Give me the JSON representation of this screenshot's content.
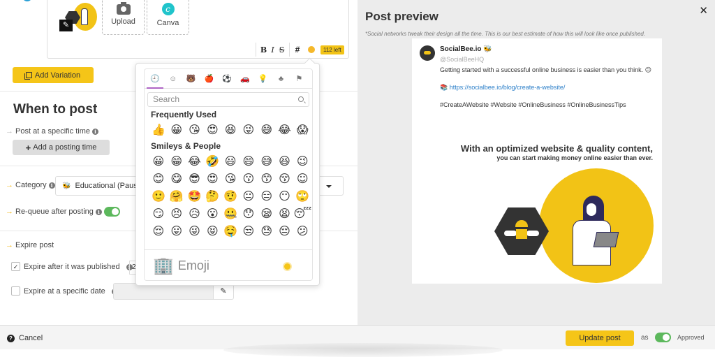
{
  "editor": {
    "upload_label": "Upload",
    "canva_label": "Canva",
    "toolbar": {
      "bold": "B",
      "italic": "I",
      "strike": "S",
      "hashtag": "#",
      "chars_left": "112 left"
    }
  },
  "add_variation_label": "Add Variation",
  "when_to_post": {
    "title": "When to post",
    "specific_time_label": "Post at a specific time",
    "add_time_label": "Add a posting time"
  },
  "category": {
    "label": "Category",
    "selected": "Educational (Paused)",
    "selected_visible": "Educational (Pause",
    "icon": "🐝"
  },
  "requeue": {
    "label": "Re-queue after posting",
    "enabled": true
  },
  "expire": {
    "label": "Expire post",
    "after_published": {
      "label": "Expire after it was published",
      "checked": true,
      "value": "2"
    },
    "specific_date": {
      "label": "Expire at a specific date",
      "checked": false,
      "value": ""
    }
  },
  "emoji_picker": {
    "categories": [
      "recent-icon",
      "smileys-icon",
      "animals-icon",
      "food-icon",
      "activity-icon",
      "travel-icon",
      "objects-icon",
      "symbols-icon",
      "flags-icon"
    ],
    "category_glyphs": [
      "🕘",
      "☺",
      "🐻",
      "🍎",
      "⚽",
      "🚗",
      "💡",
      "♣",
      "⚑"
    ],
    "search_placeholder": "Search",
    "frequently_used_title": "Frequently Used",
    "frequently_used": [
      "👍",
      "😀",
      "😘",
      "😍",
      "😆",
      "😜",
      "😅",
      "😂",
      "😱"
    ],
    "smileys_title": "Smileys & People",
    "smileys": [
      "😀",
      "😁",
      "😂",
      "🤣",
      "😃",
      "😄",
      "😅",
      "😆",
      "😉",
      "😊",
      "😋",
      "😎",
      "😍",
      "😘",
      "😗",
      "😙",
      "😚",
      "☺",
      "🙂",
      "🤗",
      "🤩",
      "🤔",
      "🤨",
      "😐",
      "😑",
      "😶",
      "🙄",
      "😏",
      "😣",
      "😥",
      "😮",
      "🤐",
      "😯",
      "😪",
      "😫",
      "😴",
      "😌",
      "😛",
      "😜",
      "😝",
      "🤤",
      "😒",
      "😓",
      "😔",
      "😕"
    ],
    "footer_emoji": "🏢",
    "footer_label": "Emoji"
  },
  "preview": {
    "title": "Post preview",
    "disclaimer": "*Social networks tweak their design all the time. This is our best estimate of how this will look like once published.",
    "account_name": "SocialBee.io 🐝",
    "handle": "@SocialBeeHQ",
    "text": "Getting started with a successful online business is easier than you think. 😉",
    "link_prefix": "📚",
    "link": "https://socialbee.io/blog/create-a-website/",
    "hashtags": "#CreateAWebsite #Website #OnlineBusiness #OnlineBusinessTips",
    "image_headline": "With an optimized website & quality content,",
    "image_subheadline": "you can start making money online easier than ever."
  },
  "footer": {
    "cancel_label": "Cancel",
    "update_label": "Update post",
    "as_label": "as",
    "status_label": "Approved",
    "status_on": true
  },
  "colors": {
    "accent_yellow": "#f5c518",
    "toggle_green": "#5cb85c",
    "tab_underline": "#ae65c5",
    "link_blue": "#2a7ec8"
  }
}
